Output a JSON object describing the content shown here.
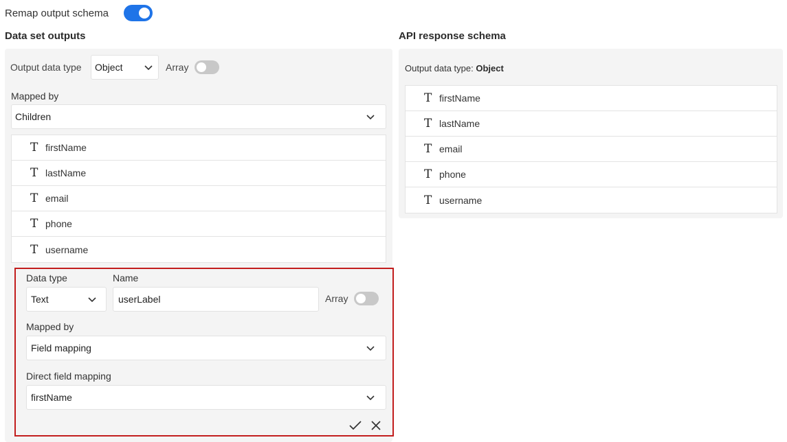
{
  "remap": {
    "label": "Remap output schema",
    "enabled": true
  },
  "left": {
    "heading": "Data set outputs",
    "output_type_label": "Output data type",
    "output_type_value": "Object",
    "array_label": "Array",
    "mapped_by_label": "Mapped by",
    "mapped_by_value": "Children",
    "fields": [
      {
        "type_icon": "T",
        "name": "firstName"
      },
      {
        "type_icon": "T",
        "name": "lastName"
      },
      {
        "type_icon": "T",
        "name": "email"
      },
      {
        "type_icon": "T",
        "name": "phone"
      },
      {
        "type_icon": "T",
        "name": "username"
      }
    ]
  },
  "editor": {
    "data_type_label": "Data type",
    "data_type_value": "Text",
    "name_label": "Name",
    "name_value": "userLabel",
    "array_label": "Array",
    "mapped_by_label": "Mapped by",
    "mapped_by_value": "Field mapping",
    "direct_label": "Direct field mapping",
    "direct_value": "firstName",
    "highlight_color": "#c21d1d"
  },
  "right": {
    "heading": "API response schema",
    "type_prefix": "Output data type:",
    "type_value": "Object",
    "fields": [
      {
        "type_icon": "T",
        "name": "firstName"
      },
      {
        "type_icon": "T",
        "name": "lastName"
      },
      {
        "type_icon": "T",
        "name": "email"
      },
      {
        "type_icon": "T",
        "name": "phone"
      },
      {
        "type_icon": "T",
        "name": "username"
      }
    ]
  },
  "colors": {
    "accent": "#1f74e8",
    "panel": "#f4f4f4",
    "toggle_off": "#c8c8c8"
  }
}
